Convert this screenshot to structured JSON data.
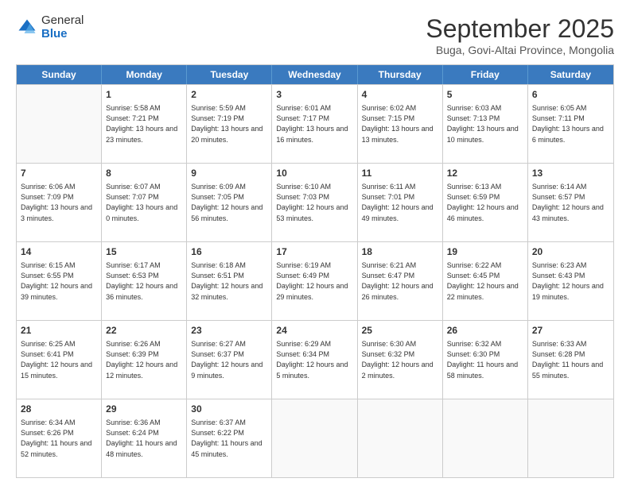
{
  "logo": {
    "general": "General",
    "blue": "Blue"
  },
  "header": {
    "month": "September 2025",
    "location": "Buga, Govi-Altai Province, Mongolia"
  },
  "days": [
    "Sunday",
    "Monday",
    "Tuesday",
    "Wednesday",
    "Thursday",
    "Friday",
    "Saturday"
  ],
  "weeks": [
    [
      {
        "day": "",
        "empty": true
      },
      {
        "day": "1",
        "sunrise": "5:58 AM",
        "sunset": "7:21 PM",
        "daylight": "13 hours and 23 minutes."
      },
      {
        "day": "2",
        "sunrise": "5:59 AM",
        "sunset": "7:19 PM",
        "daylight": "13 hours and 20 minutes."
      },
      {
        "day": "3",
        "sunrise": "6:01 AM",
        "sunset": "7:17 PM",
        "daylight": "13 hours and 16 minutes."
      },
      {
        "day": "4",
        "sunrise": "6:02 AM",
        "sunset": "7:15 PM",
        "daylight": "13 hours and 13 minutes."
      },
      {
        "day": "5",
        "sunrise": "6:03 AM",
        "sunset": "7:13 PM",
        "daylight": "13 hours and 10 minutes."
      },
      {
        "day": "6",
        "sunrise": "6:05 AM",
        "sunset": "7:11 PM",
        "daylight": "13 hours and 6 minutes."
      }
    ],
    [
      {
        "day": "7",
        "sunrise": "6:06 AM",
        "sunset": "7:09 PM",
        "daylight": "13 hours and 3 minutes."
      },
      {
        "day": "8",
        "sunrise": "6:07 AM",
        "sunset": "7:07 PM",
        "daylight": "13 hours and 0 minutes."
      },
      {
        "day": "9",
        "sunrise": "6:09 AM",
        "sunset": "7:05 PM",
        "daylight": "12 hours and 56 minutes."
      },
      {
        "day": "10",
        "sunrise": "6:10 AM",
        "sunset": "7:03 PM",
        "daylight": "12 hours and 53 minutes."
      },
      {
        "day": "11",
        "sunrise": "6:11 AM",
        "sunset": "7:01 PM",
        "daylight": "12 hours and 49 minutes."
      },
      {
        "day": "12",
        "sunrise": "6:13 AM",
        "sunset": "6:59 PM",
        "daylight": "12 hours and 46 minutes."
      },
      {
        "day": "13",
        "sunrise": "6:14 AM",
        "sunset": "6:57 PM",
        "daylight": "12 hours and 43 minutes."
      }
    ],
    [
      {
        "day": "14",
        "sunrise": "6:15 AM",
        "sunset": "6:55 PM",
        "daylight": "12 hours and 39 minutes."
      },
      {
        "day": "15",
        "sunrise": "6:17 AM",
        "sunset": "6:53 PM",
        "daylight": "12 hours and 36 minutes."
      },
      {
        "day": "16",
        "sunrise": "6:18 AM",
        "sunset": "6:51 PM",
        "daylight": "12 hours and 32 minutes."
      },
      {
        "day": "17",
        "sunrise": "6:19 AM",
        "sunset": "6:49 PM",
        "daylight": "12 hours and 29 minutes."
      },
      {
        "day": "18",
        "sunrise": "6:21 AM",
        "sunset": "6:47 PM",
        "daylight": "12 hours and 26 minutes."
      },
      {
        "day": "19",
        "sunrise": "6:22 AM",
        "sunset": "6:45 PM",
        "daylight": "12 hours and 22 minutes."
      },
      {
        "day": "20",
        "sunrise": "6:23 AM",
        "sunset": "6:43 PM",
        "daylight": "12 hours and 19 minutes."
      }
    ],
    [
      {
        "day": "21",
        "sunrise": "6:25 AM",
        "sunset": "6:41 PM",
        "daylight": "12 hours and 15 minutes."
      },
      {
        "day": "22",
        "sunrise": "6:26 AM",
        "sunset": "6:39 PM",
        "daylight": "12 hours and 12 minutes."
      },
      {
        "day": "23",
        "sunrise": "6:27 AM",
        "sunset": "6:37 PM",
        "daylight": "12 hours and 9 minutes."
      },
      {
        "day": "24",
        "sunrise": "6:29 AM",
        "sunset": "6:34 PM",
        "daylight": "12 hours and 5 minutes."
      },
      {
        "day": "25",
        "sunrise": "6:30 AM",
        "sunset": "6:32 PM",
        "daylight": "12 hours and 2 minutes."
      },
      {
        "day": "26",
        "sunrise": "6:32 AM",
        "sunset": "6:30 PM",
        "daylight": "11 hours and 58 minutes."
      },
      {
        "day": "27",
        "sunrise": "6:33 AM",
        "sunset": "6:28 PM",
        "daylight": "11 hours and 55 minutes."
      }
    ],
    [
      {
        "day": "28",
        "sunrise": "6:34 AM",
        "sunset": "6:26 PM",
        "daylight": "11 hours and 52 minutes."
      },
      {
        "day": "29",
        "sunrise": "6:36 AM",
        "sunset": "6:24 PM",
        "daylight": "11 hours and 48 minutes."
      },
      {
        "day": "30",
        "sunrise": "6:37 AM",
        "sunset": "6:22 PM",
        "daylight": "11 hours and 45 minutes."
      },
      {
        "day": "",
        "empty": true
      },
      {
        "day": "",
        "empty": true
      },
      {
        "day": "",
        "empty": true
      },
      {
        "day": "",
        "empty": true
      }
    ]
  ]
}
